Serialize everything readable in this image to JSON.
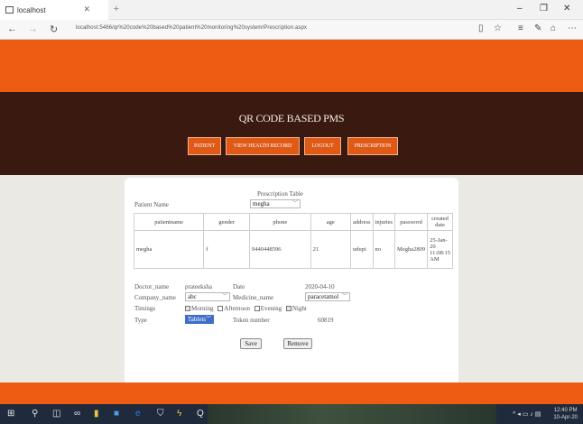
{
  "browser": {
    "tab_title": "localhost",
    "url": "localhost:5466/qr%20code%20based%20patient%20monitoring%20system/Prescription.aspx"
  },
  "site": {
    "brand": "QR CODE BASED PMS",
    "nav": [
      "PATIENT",
      "VIEW HEALTH RECORD",
      "LOGOUT",
      "PRESCRIPTION"
    ]
  },
  "form": {
    "table_title": "Prescription Table",
    "patient_name_label": "Patient Name",
    "patient_name_value": "megha",
    "columns": [
      "patientname",
      "gender",
      "phone",
      "age",
      "address",
      "injuries",
      "password",
      "created date"
    ],
    "rows": [
      [
        "megha",
        "f",
        "9440448596",
        "21",
        "udupi",
        "no",
        "Megha2809",
        "25-Jan-20 11:08:15 AM"
      ]
    ],
    "doctor_name_label": "Doctor_name",
    "doctor_name_value": "prateeksha",
    "date_label": "Date",
    "date_value": "2020-04-10",
    "company_name_label": "Company_name",
    "company_name_value": "abc",
    "medicine_name_label": "Medicine_name",
    "medicine_name_value": "paracetamol",
    "timings_label": "Timings",
    "timings": [
      {
        "label": "Morning",
        "checked": true
      },
      {
        "label": "Afternoon",
        "checked": false
      },
      {
        "label": "Evening",
        "checked": false
      },
      {
        "label": "Night",
        "checked": true
      }
    ],
    "type_label": "Type",
    "type_value": "Tablets",
    "token_label": "Token number",
    "token_value": "60819",
    "save_label": "Save",
    "remove_label": "Remove"
  },
  "taskbar": {
    "time": "12:40 PM",
    "date": "10-Apr-20"
  },
  "colors": {
    "orange": "#ed5c12",
    "header_dark": "#3a1a10",
    "nav_button": "#e05a17"
  }
}
